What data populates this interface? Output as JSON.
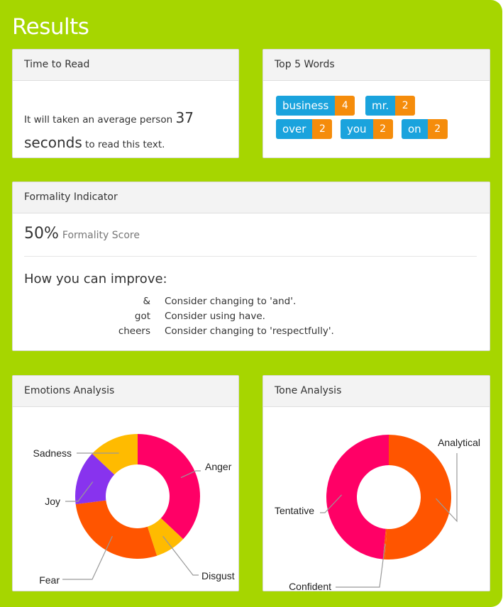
{
  "page": {
    "title": "Results"
  },
  "time_to_read": {
    "header": "Time to Read",
    "prefix": "It will taken an average person",
    "number": "37",
    "unit": "seconds",
    "suffix": "to read this text."
  },
  "top_words": {
    "header": "Top 5 Words",
    "items": [
      {
        "word": "business",
        "count": "4"
      },
      {
        "word": "mr.",
        "count": "2"
      },
      {
        "word": "over",
        "count": "2"
      },
      {
        "word": "you",
        "count": "2"
      },
      {
        "word": "on",
        "count": "2"
      }
    ]
  },
  "formality": {
    "header": "Formality Indicator",
    "score": "50%",
    "score_label": "Formality Score",
    "improve_heading": "How you can improve:",
    "tips": [
      {
        "word": "&",
        "message": "Consider changing to 'and'."
      },
      {
        "word": "got",
        "message": "Consider using have."
      },
      {
        "word": "cheers",
        "message": "Consider changing to 'respectfully'."
      }
    ]
  },
  "colors": {
    "frame": "#a6d600",
    "chip_word": "#1aa3dd",
    "chip_count": "#f58c0b",
    "anger": "#ff0066",
    "disgust": "#ffbb00",
    "fear": "#ff5500",
    "joy": "#8833ee",
    "sadness": "#ffbb00",
    "analytical": "#ff5500",
    "tentative": "#ff0066",
    "confident": "#ff5500"
  },
  "emotions": {
    "header": "Emotions Analysis",
    "chart_data": {
      "type": "pie",
      "categories": [
        "Anger",
        "Disgust",
        "Fear",
        "Joy",
        "Sadness"
      ],
      "values": [
        37,
        8,
        28,
        14,
        13
      ]
    }
  },
  "tone": {
    "header": "Tone Analysis",
    "chart_data": {
      "type": "pie",
      "categories": [
        "Analytical",
        "Confident",
        "Tentative"
      ],
      "values": [
        51,
        0.5,
        48.5
      ]
    }
  }
}
